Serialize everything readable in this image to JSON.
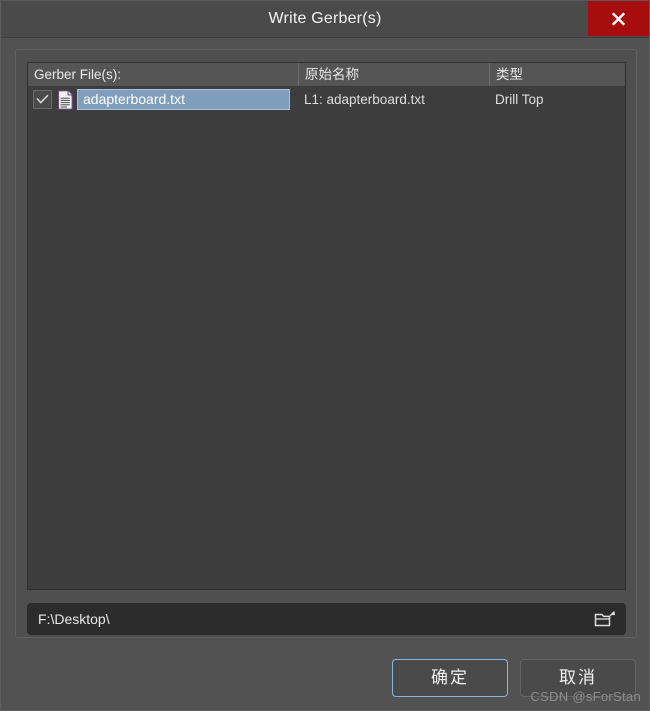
{
  "window": {
    "title": "Write Gerber(s)",
    "close_icon": "close-icon",
    "close_color": "#a80d0d"
  },
  "file_list": {
    "columns": [
      {
        "id": "name",
        "label": "Gerber File(s):"
      },
      {
        "id": "original_name",
        "label": "原始名称"
      },
      {
        "id": "type",
        "label": "类型"
      }
    ],
    "rows": [
      {
        "checked": true,
        "check_icon": "check-icon",
        "file_icon": "document-icon",
        "name": "adapterboard.txt",
        "original_name": "L1: adapterboard.txt",
        "type": "Drill Top",
        "selected": true
      }
    ],
    "selection_color": "#7f9dbd"
  },
  "path": {
    "value": "F:\\Desktop\\",
    "placeholder": "F:\\Desktop\\",
    "browse_icon": "open-folder-icon"
  },
  "footer": {
    "ok_label": "确定",
    "cancel_label": "取消",
    "focus_color": "#8ab4dd"
  },
  "watermark": {
    "text": "CSDN @sForStan"
  }
}
